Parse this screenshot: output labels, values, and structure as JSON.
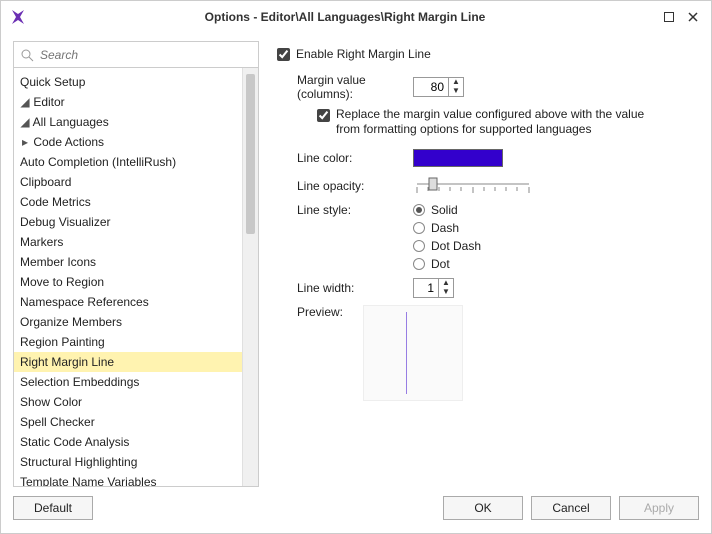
{
  "title": "Options - Editor\\All Languages\\Right Margin Line",
  "search": {
    "placeholder": "Search"
  },
  "tree": {
    "quick_setup": "Quick Setup",
    "editor": "Editor",
    "all_languages": "All Languages",
    "items": [
      "Code Actions",
      "Auto Completion (IntelliRush)",
      "Clipboard",
      "Code Metrics",
      "Debug Visualizer",
      "Markers",
      "Member Icons",
      "Move to Region",
      "Namespace References",
      "Organize Members",
      "Region Painting",
      "Right Margin Line",
      "Selection Embeddings",
      "Show Color",
      "Spell Checker",
      "Static Code Analysis",
      "Structural Highlighting",
      "Template Name Variables"
    ],
    "selected": "Right Margin Line"
  },
  "panel": {
    "enable": "Enable Right Margin Line",
    "margin_label": "Margin value (columns):",
    "margin_value": "80",
    "replace": "Replace the margin value configured above with the value from formatting options for supported languages",
    "line_color_label": "Line color:",
    "line_color": "#3300cc",
    "line_opacity_label": "Line opacity:",
    "line_style_label": "Line style:",
    "styles": {
      "solid": "Solid",
      "dash": "Dash",
      "dotdash": "Dot Dash",
      "dot": "Dot"
    },
    "style_selected": "solid",
    "line_width_label": "Line width:",
    "line_width": "1",
    "preview_label": "Preview:"
  },
  "buttons": {
    "default": "Default",
    "ok": "OK",
    "cancel": "Cancel",
    "apply": "Apply"
  }
}
